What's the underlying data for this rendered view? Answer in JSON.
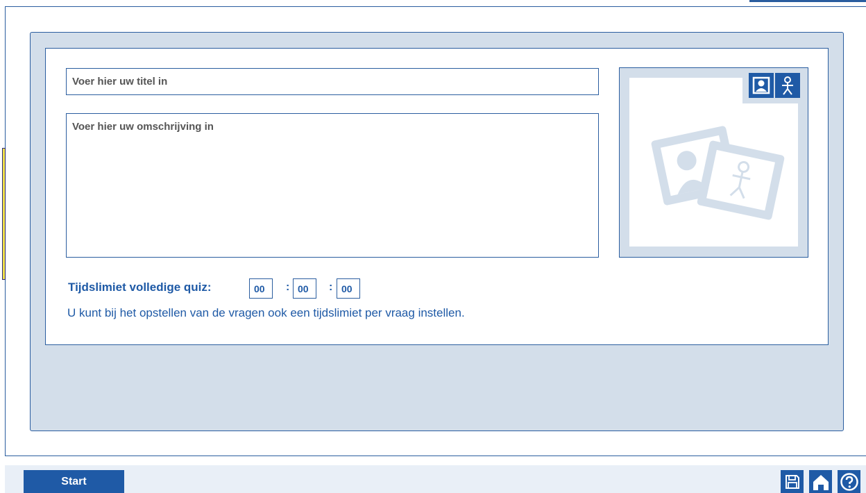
{
  "form": {
    "title_placeholder": "Voer hier uw titel in",
    "description_placeholder": "Voer hier uw omschrijving in"
  },
  "image": {
    "buttons": [
      {
        "icon": "portrait-icon"
      },
      {
        "icon": "person-icon"
      }
    ],
    "placeholder_icon": "photos-placeholder-icon"
  },
  "time_limit": {
    "label": "Tijdslimiet volledige quiz:",
    "hours": "00",
    "minutes": "00",
    "seconds": "00",
    "separator": ":",
    "hint": "U kunt bij het opstellen van de vragen ook een tijdslimiet per vraag instellen."
  },
  "footer": {
    "start_label": "Start",
    "icons": [
      "save-icon",
      "home-icon",
      "help-icon"
    ]
  },
  "colors": {
    "accent": "#1f5aa6",
    "panel": "#d3deea",
    "border": "#2a5d9f"
  }
}
